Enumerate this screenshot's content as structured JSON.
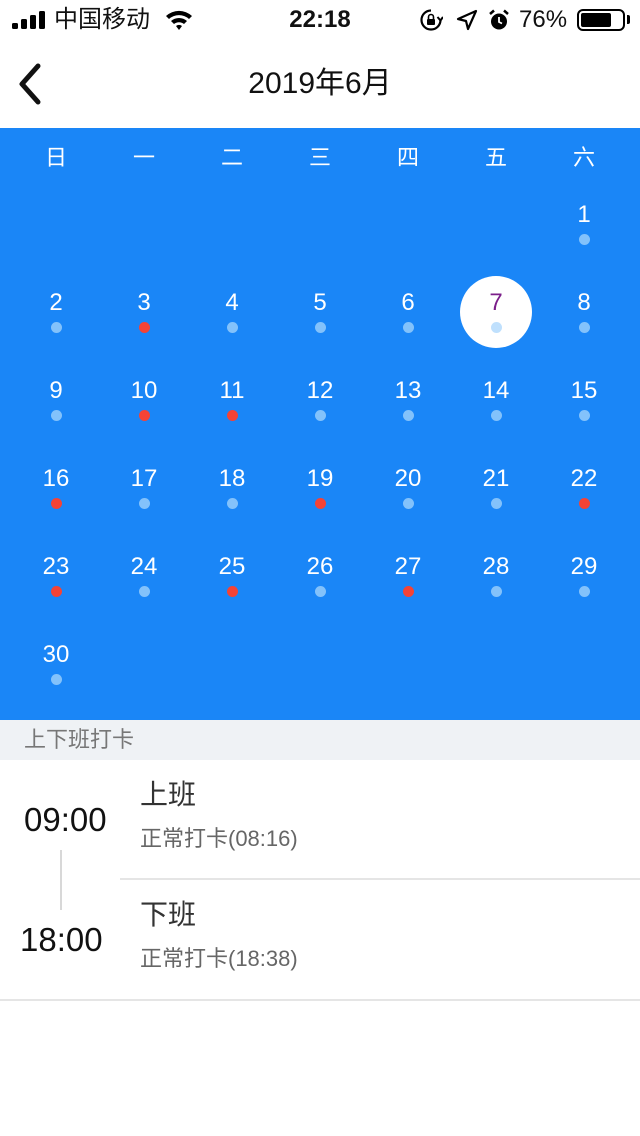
{
  "status_bar": {
    "carrier": "中国移动",
    "time": "22:18",
    "battery_percent": "76%",
    "battery_level": 0.76,
    "icons": [
      "signal-icon",
      "wifi-icon",
      "orientation-lock-icon",
      "location-icon",
      "alarm-icon",
      "battery-icon"
    ]
  },
  "nav": {
    "title": "2019年6月",
    "back_icon": "chevron-left-icon"
  },
  "calendar": {
    "weekdays": [
      "日",
      "一",
      "二",
      "三",
      "四",
      "五",
      "六"
    ],
    "first_weekday_index": 6,
    "selected_day": 7,
    "colors": {
      "background": "#1a86f7",
      "dot_normal": "#83c2fb",
      "dot_red": "#f44336",
      "selected_text": "#7b1f8a"
    },
    "days": [
      {
        "day": "1",
        "dot": "normal"
      },
      {
        "day": "2",
        "dot": "normal"
      },
      {
        "day": "3",
        "dot": "red"
      },
      {
        "day": "4",
        "dot": "normal"
      },
      {
        "day": "5",
        "dot": "normal"
      },
      {
        "day": "6",
        "dot": "normal"
      },
      {
        "day": "7",
        "dot": "normal"
      },
      {
        "day": "8",
        "dot": "normal"
      },
      {
        "day": "9",
        "dot": "normal"
      },
      {
        "day": "10",
        "dot": "red"
      },
      {
        "day": "11",
        "dot": "red"
      },
      {
        "day": "12",
        "dot": "normal"
      },
      {
        "day": "13",
        "dot": "normal"
      },
      {
        "day": "14",
        "dot": "normal"
      },
      {
        "day": "15",
        "dot": "normal"
      },
      {
        "day": "16",
        "dot": "red"
      },
      {
        "day": "17",
        "dot": "normal"
      },
      {
        "day": "18",
        "dot": "normal"
      },
      {
        "day": "19",
        "dot": "red"
      },
      {
        "day": "20",
        "dot": "normal"
      },
      {
        "day": "21",
        "dot": "normal"
      },
      {
        "day": "22",
        "dot": "red"
      },
      {
        "day": "23",
        "dot": "red"
      },
      {
        "day": "24",
        "dot": "normal"
      },
      {
        "day": "25",
        "dot": "red"
      },
      {
        "day": "26",
        "dot": "normal"
      },
      {
        "day": "27",
        "dot": "red"
      },
      {
        "day": "28",
        "dot": "normal"
      },
      {
        "day": "29",
        "dot": "normal"
      },
      {
        "day": "30",
        "dot": "normal"
      }
    ]
  },
  "section": {
    "title": "上下班打卡"
  },
  "records": [
    {
      "time": "09:00",
      "title": "上班",
      "status": "正常打卡(08:16)"
    },
    {
      "time": "18:00",
      "title": "下班",
      "status": "正常打卡(18:38)"
    }
  ]
}
